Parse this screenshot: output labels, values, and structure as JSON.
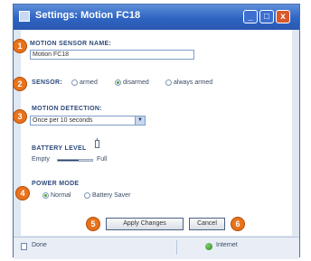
{
  "window": {
    "title": "Settings: Motion FC18",
    "minimize": "_",
    "maximize": "□",
    "close": "x"
  },
  "form": {
    "motion_sensor_name": {
      "label": "MOTION SENSOR NAME:",
      "value": "Motion FC18"
    },
    "sensor": {
      "label": "SENSOR:",
      "options": [
        "armed",
        "disarmed",
        "always armed"
      ],
      "selected": "disarmed"
    },
    "motion_detection": {
      "label": "MOTION DETECTION:",
      "value": "Once per 10 seconds",
      "arrow": "▼"
    },
    "battery": {
      "label": "BATTERY LEVEL",
      "empty_label": "Empty",
      "full_label": "Full",
      "level_fraction": 0.6
    },
    "power_mode": {
      "label": "POWER MODE",
      "options": [
        "Normal",
        "Battery Saver"
      ],
      "selected": "Normal"
    }
  },
  "buttons": {
    "apply": "Apply Changes",
    "cancel": "Cancel"
  },
  "markers": [
    "1",
    "2",
    "3",
    "4",
    "5",
    "6"
  ],
  "statusbar": {
    "left": "Done",
    "zone": "Internet"
  },
  "colors": {
    "titlebar": "#2f64c2",
    "marker": "#e8731b",
    "label": "#2d4a7c"
  }
}
